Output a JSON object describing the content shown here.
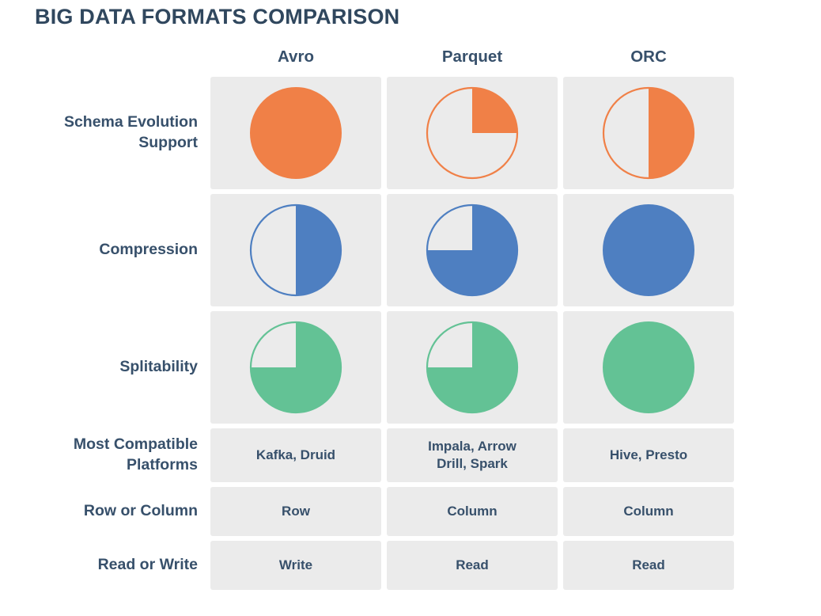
{
  "title": "BIG DATA FORMATS COMPARISON",
  "colors": {
    "title": "#30475E",
    "text": "#37506B",
    "cell_background": "#EBEBEB",
    "orange": "#F08047",
    "blue": "#4E7FC1",
    "green": "#63C295",
    "page_background": "#FFFFFF"
  },
  "columns": [
    {
      "label": "Avro"
    },
    {
      "label": "Parquet"
    },
    {
      "label": "ORC"
    }
  ],
  "rows": [
    {
      "label": "Schema Evolution\nSupport",
      "type": "pie",
      "color": "#F08047",
      "values": [
        100,
        25,
        50
      ]
    },
    {
      "label": "Compression",
      "type": "pie",
      "color": "#4E7FC1",
      "values": [
        50,
        75,
        100
      ]
    },
    {
      "label": "Splitability",
      "type": "pie",
      "color": "#63C295",
      "values": [
        75,
        75,
        100
      ]
    },
    {
      "label": "Most Compatible\nPlatforms",
      "type": "text",
      "values": [
        "Kafka, Druid",
        "Impala, Arrow\nDrill, Spark",
        "Hive, Presto"
      ]
    },
    {
      "label": "Row or Column",
      "type": "text",
      "values": [
        "Row",
        "Column",
        "Column"
      ]
    },
    {
      "label": "Read or Write",
      "type": "text",
      "values": [
        "Write",
        "Read",
        "Read"
      ]
    }
  ],
  "chart_data": {
    "type": "pie",
    "title": "BIG DATA FORMATS COMPARISON",
    "categories": [
      "Avro",
      "Parquet",
      "ORC"
    ],
    "series": [
      {
        "name": "Schema Evolution Support",
        "values": [
          100,
          25,
          50
        ],
        "unit": "%",
        "color": "#F08047"
      },
      {
        "name": "Compression",
        "values": [
          50,
          75,
          100
        ],
        "unit": "%",
        "color": "#4E7FC1"
      },
      {
        "name": "Splitability",
        "values": [
          75,
          75,
          100
        ],
        "unit": "%",
        "color": "#63C295"
      }
    ],
    "text_rows": [
      {
        "name": "Most Compatible Platforms",
        "values": [
          "Kafka, Druid",
          "Impala, Arrow Drill, Spark",
          "Hive, Presto"
        ]
      },
      {
        "name": "Row or Column",
        "values": [
          "Row",
          "Column",
          "Column"
        ]
      },
      {
        "name": "Read or Write",
        "values": [
          "Write",
          "Read",
          "Read"
        ]
      }
    ],
    "xlabel": "",
    "ylabel": "",
    "legend": "none",
    "grid": false
  }
}
